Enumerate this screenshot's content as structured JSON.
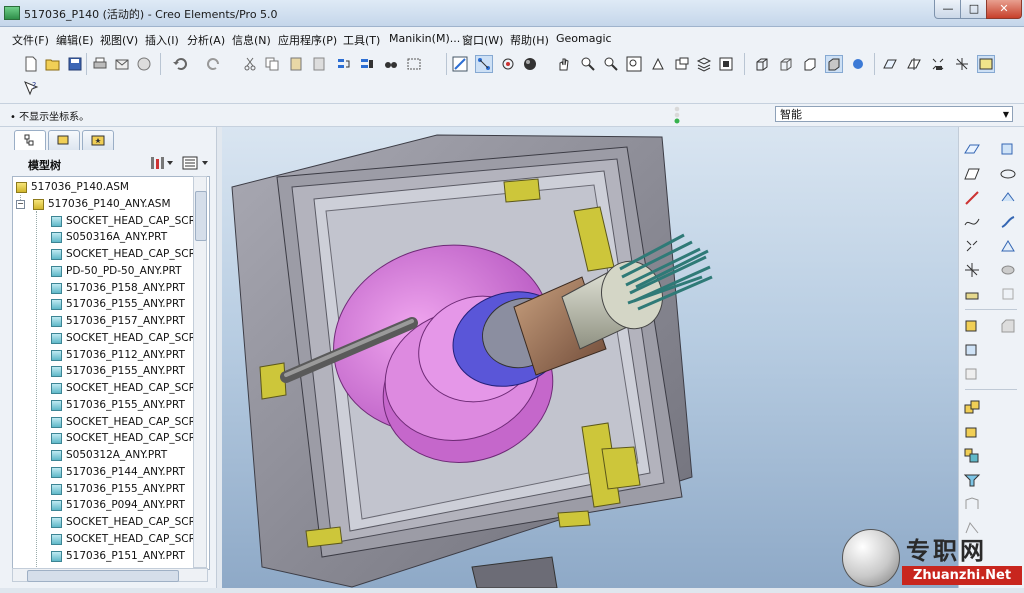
{
  "window": {
    "title": "517036_P140 (活动的) - Creo Elements/Pro 5.0"
  },
  "menu": [
    "文件(F)",
    "编辑(E)",
    "视图(V)",
    "插入(I)",
    "分析(A)",
    "信息(N)",
    "应用程序(P)",
    "工具(T)",
    "Manikin(M)...",
    "窗口(W)",
    "帮助(H)",
    "Geomagic"
  ],
  "message": "• 不显示坐标系。",
  "filter": {
    "value": "智能"
  },
  "navigator": {
    "title": "模型树",
    "tabs": [
      "model-tree",
      "layer-tree",
      "favorites"
    ],
    "tree": [
      {
        "label": "517036_P140.ASM",
        "type": "asm",
        "level": 0
      },
      {
        "label": "517036_P140_ANY.ASM",
        "type": "asm",
        "level": 1
      },
      {
        "label": "SOCKET_HEAD_CAP_SCRE",
        "type": "prt",
        "level": 2
      },
      {
        "label": "S050316A_ANY.PRT",
        "type": "prt",
        "level": 2
      },
      {
        "label": "SOCKET_HEAD_CAP_SCRE",
        "type": "prt",
        "level": 2
      },
      {
        "label": "PD-50_PD-50_ANY.PRT",
        "type": "prt",
        "level": 2
      },
      {
        "label": "517036_P158_ANY.PRT",
        "type": "prt",
        "level": 2
      },
      {
        "label": "517036_P155_ANY.PRT",
        "type": "prt",
        "level": 2
      },
      {
        "label": "517036_P157_ANY.PRT",
        "type": "prt",
        "level": 2
      },
      {
        "label": "SOCKET_HEAD_CAP_SCRE",
        "type": "prt",
        "level": 2
      },
      {
        "label": "517036_P112_ANY.PRT",
        "type": "prt",
        "level": 2
      },
      {
        "label": "517036_P155_ANY.PRT",
        "type": "prt",
        "level": 2
      },
      {
        "label": "SOCKET_HEAD_CAP_SCRE",
        "type": "prt",
        "level": 2
      },
      {
        "label": "517036_P155_ANY.PRT",
        "type": "prt",
        "level": 2
      },
      {
        "label": "SOCKET_HEAD_CAP_SCRE",
        "type": "prt",
        "level": 2
      },
      {
        "label": "SOCKET_HEAD_CAP_SCRE",
        "type": "prt",
        "level": 2
      },
      {
        "label": "S050312A_ANY.PRT",
        "type": "prt",
        "level": 2
      },
      {
        "label": "517036_P144_ANY.PRT",
        "type": "prt",
        "level": 2
      },
      {
        "label": "517036_P155_ANY.PRT",
        "type": "prt",
        "level": 2
      },
      {
        "label": "517036_P094_ANY.PRT",
        "type": "prt",
        "level": 2
      },
      {
        "label": "SOCKET_HEAD_CAP_SCRE",
        "type": "prt",
        "level": 2
      },
      {
        "label": "SOCKET_HEAD_CAP_SCRE",
        "type": "prt",
        "level": 2
      },
      {
        "label": "517036_P151_ANY.PRT",
        "type": "prt",
        "level": 2
      }
    ]
  },
  "watermark": {
    "cn": "专职网",
    "en": "Zhuanzhi.Net"
  },
  "colors": {
    "frame": "#8d8d96",
    "pink": "#d46fd6",
    "blue_ring": "#5a56d8",
    "bronze": "#a87a5e",
    "yellow_pad": "#cdc63a",
    "teal_wire": "#2f7a77"
  }
}
